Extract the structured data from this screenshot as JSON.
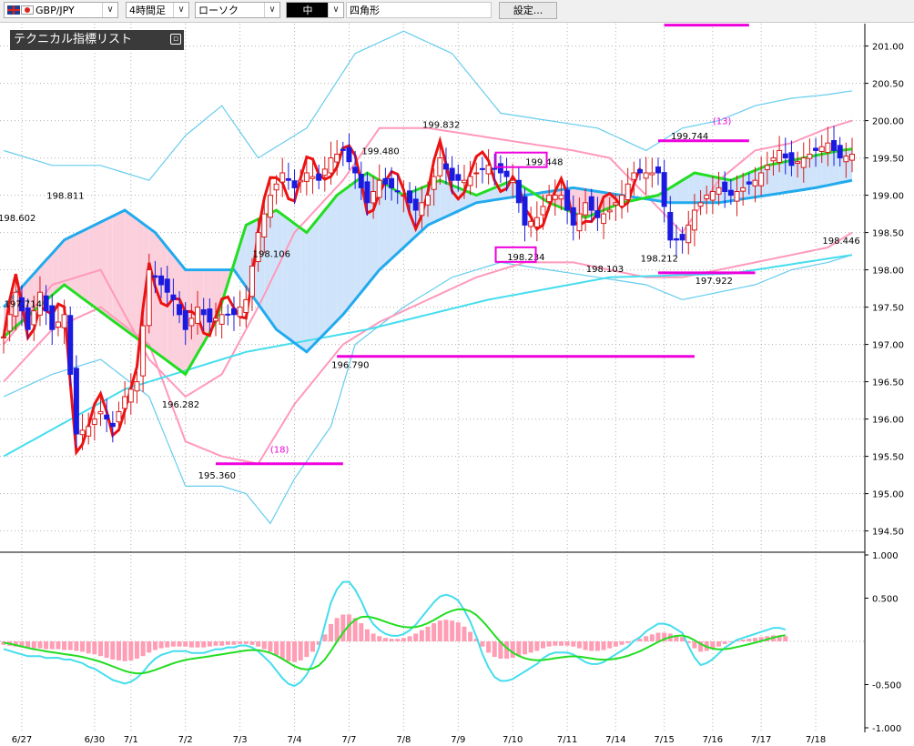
{
  "toolbar": {
    "pair": "GBP/JPY",
    "timeframe": "4時間足",
    "chart_style": "ローソク",
    "line_width": "中",
    "shape": "四角形",
    "settings": "設定..."
  },
  "indicator_list": {
    "label": "テクニカル指標リスト",
    "icon": "collapse-icon"
  },
  "colors": {
    "bull_candle": "#d61a1a",
    "bear_candle": "#1a1ae0",
    "price_line": "#ee1111",
    "bollinger_outer": "#66ccee",
    "bollinger_2": "#ff99bb",
    "moving_avg_green": "#22dd22",
    "moving_avg_blue": "#22aaee",
    "moving_avg_cyan": "#44ddee",
    "cloud_up": "#cfe4fa",
    "cloud_down": "#fbd0dc",
    "marker": "#ee00dd",
    "macd_hist": "#ff9db4"
  },
  "chart_data": {
    "type": "line",
    "pair": "GBP/JPY",
    "timeframe": "4時間足",
    "ylim": [
      194.3,
      201.3
    ],
    "x_tick_labels": [
      "6/27",
      "6/30",
      "7/1",
      "7/2",
      "7/3",
      "7/4",
      "7/7",
      "7/8",
      "7/9",
      "7/10",
      "7/11",
      "7/14",
      "7/15",
      "7/16",
      "7/17",
      "7/18"
    ],
    "y_tick_labels": [
      "201.00",
      "200.50",
      "200.00",
      "199.50",
      "199.00",
      "198.50",
      "198.00",
      "197.50",
      "197.00",
      "196.50",
      "196.00",
      "195.50",
      "195.00",
      "194.50"
    ],
    "price_annotations": [
      "198.602",
      "198.811",
      "197.714",
      "198.106",
      "196.282",
      "195.360",
      "196.790",
      "199.480",
      "199.832",
      "199.448",
      "198.234",
      "198.103",
      "198.212",
      "199.744",
      "197.922",
      "198.446"
    ],
    "cycle_annotations": [
      "(18)",
      "(13)"
    ],
    "series": [
      {
        "points": [
          [
            0,
            197.1
          ],
          [
            2,
            197.7
          ],
          [
            4,
            197.2
          ],
          [
            6,
            197.7
          ],
          [
            8,
            197.2
          ],
          [
            10,
            197.4
          ],
          [
            12,
            195.8
          ],
          [
            14,
            195.9
          ],
          [
            16,
            196.1
          ],
          [
            18,
            195.9
          ],
          [
            20,
            196.3
          ],
          [
            22,
            196.5
          ],
          [
            24,
            198.0
          ],
          [
            26,
            197.8
          ],
          [
            28,
            197.6
          ],
          [
            30,
            197.2
          ],
          [
            32,
            197.5
          ],
          [
            34,
            197.3
          ],
          [
            36,
            197.4
          ],
          [
            38,
            197.4
          ],
          [
            40,
            197.6
          ],
          [
            42,
            198.5
          ],
          [
            44,
            199.0
          ],
          [
            46,
            199.3
          ],
          [
            48,
            199.1
          ],
          [
            50,
            199.3
          ],
          [
            52,
            199.2
          ],
          [
            54,
            199.5
          ],
          [
            56,
            199.6
          ],
          [
            58,
            199.3
          ],
          [
            60,
            198.9
          ],
          [
            62,
            199.2
          ],
          [
            64,
            199.1
          ],
          [
            66,
            199.0
          ],
          [
            68,
            198.8
          ],
          [
            70,
            199.0
          ],
          [
            72,
            199.5
          ],
          [
            74,
            199.2
          ],
          [
            76,
            199.2
          ],
          [
            78,
            199.3
          ],
          [
            80,
            199.4
          ],
          [
            82,
            199.3
          ],
          [
            84,
            199.2
          ],
          [
            86,
            198.6
          ],
          [
            88,
            198.7
          ],
          [
            90,
            199.0
          ],
          [
            92,
            199.0
          ],
          [
            94,
            198.6
          ],
          [
            96,
            198.9
          ],
          [
            98,
            198.7
          ],
          [
            100,
            198.8
          ],
          [
            102,
            199.0
          ],
          [
            104,
            199.3
          ],
          [
            106,
            199.3
          ],
          [
            108,
            199.3
          ],
          [
            110,
            198.4
          ],
          [
            112,
            198.4
          ],
          [
            114,
            198.8
          ],
          [
            116,
            199.0
          ],
          [
            118,
            199.1
          ],
          [
            120,
            199.0
          ],
          [
            122,
            199.1
          ],
          [
            124,
            199.2
          ],
          [
            126,
            199.4
          ],
          [
            128,
            199.6
          ],
          [
            130,
            199.4
          ],
          [
            132,
            199.5
          ],
          [
            134,
            199.6
          ],
          [
            136,
            199.7
          ],
          [
            138,
            199.5
          ],
          [
            140,
            199.55
          ]
        ]
      },
      {
        "points": [
          [
            0,
            197.1
          ],
          [
            10,
            197.8
          ],
          [
            20,
            197.2
          ],
          [
            30,
            196.6
          ],
          [
            35,
            197.3
          ],
          [
            40,
            198.6
          ],
          [
            45,
            198.8
          ],
          [
            50,
            198.5
          ],
          [
            55,
            199.0
          ],
          [
            60,
            199.3
          ],
          [
            66,
            199.0
          ],
          [
            72,
            199.2
          ],
          [
            78,
            199.0
          ],
          [
            84,
            199.2
          ],
          [
            90,
            198.9
          ],
          [
            96,
            198.7
          ],
          [
            102,
            198.9
          ],
          [
            108,
            199.0
          ],
          [
            114,
            199.3
          ],
          [
            120,
            199.2
          ],
          [
            126,
            199.4
          ],
          [
            132,
            199.5
          ],
          [
            138,
            199.6
          ],
          [
            140,
            199.62
          ]
        ]
      },
      {
        "points": [
          [
            0,
            197.5
          ],
          [
            10,
            198.4
          ],
          [
            20,
            198.8
          ],
          [
            25,
            198.5
          ],
          [
            30,
            198.0
          ],
          [
            38,
            198.0
          ],
          [
            45,
            197.2
          ],
          [
            50,
            196.9
          ],
          [
            56,
            197.4
          ],
          [
            62,
            198.0
          ],
          [
            70,
            198.6
          ],
          [
            78,
            198.9
          ],
          [
            86,
            199.0
          ],
          [
            94,
            199.1
          ],
          [
            102,
            199.0
          ],
          [
            110,
            198.9
          ],
          [
            118,
            198.9
          ],
          [
            126,
            199.0
          ],
          [
            134,
            199.1
          ],
          [
            140,
            199.2
          ]
        ]
      },
      {
        "points": [
          [
            0,
            195.5
          ],
          [
            20,
            196.4
          ],
          [
            40,
            196.9
          ],
          [
            60,
            197.2
          ],
          [
            80,
            197.6
          ],
          [
            100,
            197.9
          ],
          [
            120,
            197.95
          ],
          [
            140,
            198.2
          ]
        ]
      },
      {
        "points": [
          [
            0,
            197.0
          ],
          [
            8,
            197.8
          ],
          [
            16,
            198.0
          ],
          [
            24,
            196.8
          ],
          [
            30,
            196.3
          ],
          [
            36,
            196.6
          ],
          [
            42,
            197.5
          ],
          [
            48,
            198.5
          ],
          [
            56,
            199.2
          ],
          [
            62,
            199.9
          ],
          [
            70,
            199.9
          ],
          [
            78,
            199.8
          ],
          [
            86,
            199.7
          ],
          [
            94,
            199.6
          ],
          [
            100,
            199.5
          ],
          [
            106,
            199.0
          ],
          [
            112,
            198.5
          ],
          [
            118,
            199.2
          ],
          [
            124,
            199.6
          ],
          [
            130,
            199.7
          ],
          [
            136,
            199.9
          ],
          [
            140,
            200.0
          ]
        ]
      },
      {
        "points": [
          [
            0,
            196.5
          ],
          [
            8,
            197.2
          ],
          [
            16,
            197.5
          ],
          [
            24,
            197.0
          ],
          [
            30,
            195.7
          ],
          [
            36,
            195.5
          ],
          [
            42,
            195.4
          ],
          [
            48,
            196.2
          ],
          [
            56,
            197.0
          ],
          [
            62,
            197.3
          ],
          [
            70,
            197.6
          ],
          [
            78,
            197.9
          ],
          [
            86,
            198.1
          ],
          [
            94,
            198.1
          ],
          [
            100,
            198.0
          ],
          [
            106,
            197.9
          ],
          [
            112,
            197.9
          ],
          [
            118,
            198.0
          ],
          [
            124,
            198.1
          ],
          [
            130,
            198.2
          ],
          [
            136,
            198.3
          ],
          [
            140,
            198.5
          ]
        ]
      },
      {
        "points": [
          [
            0,
            199.6
          ],
          [
            8,
            199.4
          ],
          [
            16,
            199.4
          ],
          [
            24,
            199.2
          ],
          [
            30,
            199.8
          ],
          [
            36,
            200.2
          ],
          [
            42,
            199.5
          ],
          [
            50,
            199.9
          ],
          [
            58,
            200.9
          ],
          [
            66,
            201.2
          ],
          [
            74,
            200.9
          ],
          [
            82,
            200.1
          ],
          [
            90,
            200.0
          ],
          [
            98,
            199.9
          ],
          [
            106,
            199.6
          ],
          [
            112,
            199.9
          ],
          [
            118,
            200.0
          ],
          [
            124,
            200.2
          ],
          [
            130,
            200.3
          ],
          [
            136,
            200.35
          ],
          [
            140,
            200.4
          ]
        ]
      },
      {
        "points": [
          [
            0,
            196.3
          ],
          [
            8,
            196.6
          ],
          [
            16,
            196.8
          ],
          [
            24,
            196.3
          ],
          [
            30,
            195.1
          ],
          [
            36,
            195.1
          ],
          [
            40,
            195.0
          ],
          [
            44,
            194.6
          ],
          [
            48,
            195.2
          ],
          [
            54,
            195.9
          ],
          [
            58,
            197.0
          ],
          [
            66,
            197.5
          ],
          [
            74,
            197.9
          ],
          [
            82,
            198.1
          ],
          [
            90,
            198.0
          ],
          [
            98,
            197.9
          ],
          [
            106,
            197.8
          ],
          [
            112,
            197.6
          ],
          [
            118,
            197.7
          ],
          [
            124,
            197.8
          ],
          [
            130,
            198.0
          ],
          [
            136,
            198.1
          ],
          [
            140,
            198.2
          ]
        ]
      }
    ],
    "macd": {
      "ylim": [
        -1.0,
        1.0
      ],
      "y_tick_labels": [
        "1.000",
        "0.500",
        "-0.500",
        "-1.000"
      ],
      "histogram": [
        -0.04,
        -0.05,
        -0.06,
        -0.07,
        -0.08,
        -0.08,
        -0.08,
        -0.09,
        -0.09,
        -0.09,
        -0.1,
        -0.1,
        -0.11,
        -0.12,
        -0.14,
        -0.15,
        -0.17,
        -0.19,
        -0.21,
        -0.22,
        -0.23,
        -0.22,
        -0.2,
        -0.17,
        -0.13,
        -0.1,
        -0.08,
        -0.07,
        -0.06,
        -0.06,
        -0.06,
        -0.07,
        -0.07,
        -0.07,
        -0.06,
        -0.05,
        -0.05,
        -0.04,
        -0.04,
        -0.03,
        -0.03,
        -0.04,
        -0.06,
        -0.09,
        -0.12,
        -0.16,
        -0.2,
        -0.23,
        -0.24,
        -0.22,
        -0.18,
        -0.12,
        -0.04,
        0.08,
        0.2,
        0.27,
        0.31,
        0.31,
        0.27,
        0.21,
        0.14,
        0.09,
        0.06,
        0.04,
        0.03,
        0.03,
        0.04,
        0.06,
        0.09,
        0.13,
        0.17,
        0.21,
        0.24,
        0.25,
        0.24,
        0.22,
        0.17,
        0.11,
        0.03,
        -0.06,
        -0.13,
        -0.18,
        -0.2,
        -0.2,
        -0.19,
        -0.17,
        -0.15,
        -0.13,
        -0.11,
        -0.08,
        -0.06,
        -0.05,
        -0.05,
        -0.05,
        -0.06,
        -0.08,
        -0.1,
        -0.11,
        -0.11,
        -0.1,
        -0.08,
        -0.06,
        -0.04,
        -0.02,
        0.01,
        0.03,
        0.06,
        0.08,
        0.1,
        0.1,
        0.09,
        0.07,
        0.05,
        -0.02,
        -0.08,
        -0.12,
        -0.11,
        -0.09,
        -0.06,
        -0.03,
        -0.01,
        0.01,
        0.02,
        0.03,
        0.04,
        0.05,
        0.06,
        0.07,
        0.07,
        0.06
      ]
    }
  }
}
